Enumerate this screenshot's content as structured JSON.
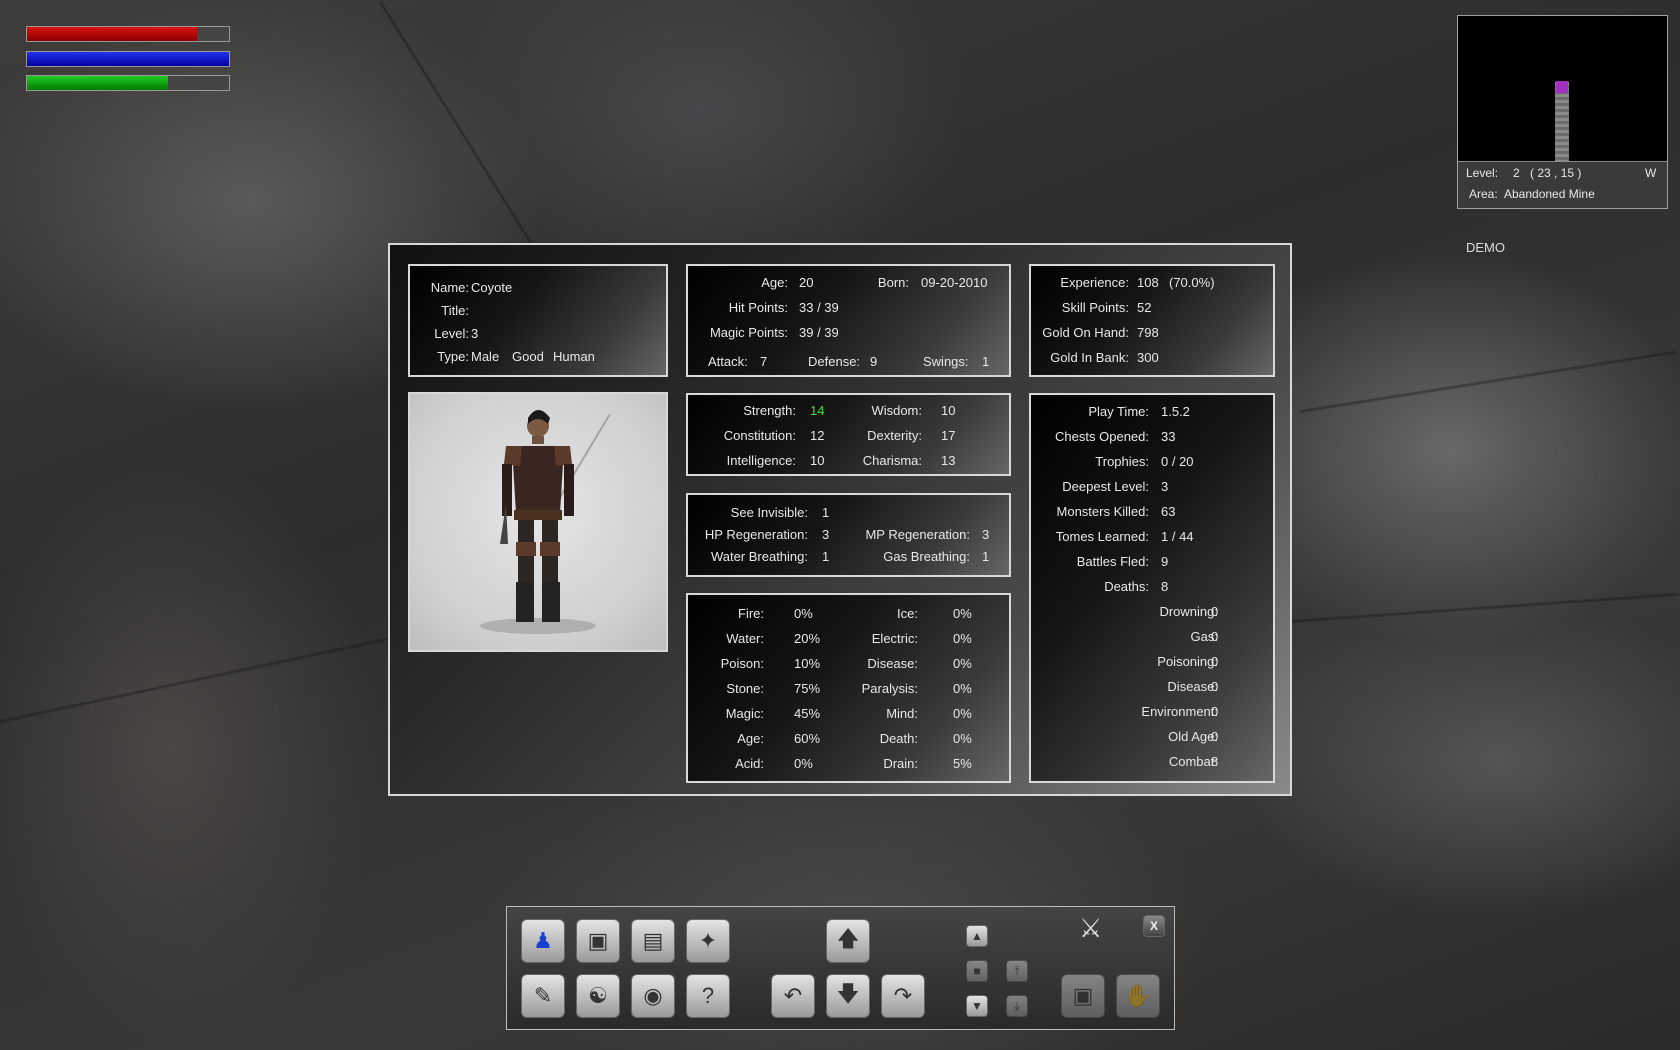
{
  "status_bars": {
    "health": 0.84,
    "mana": 1.0,
    "stamina": 0.7
  },
  "minimap": {
    "level_label": "Level:",
    "level_value": "2",
    "coords": "( 23 , 15 )",
    "facing": "W",
    "area_label": "Area:",
    "area_value": "Abandoned Mine"
  },
  "demo_label": "DEMO",
  "identity": {
    "name_label": "Name:",
    "name": "Coyote",
    "title_label": "Title:",
    "title": "",
    "level_label": "Level:",
    "level": "3",
    "type_label": "Type:",
    "gender": "Male",
    "alignment": "Good",
    "race": "Human"
  },
  "vitals": {
    "age_label": "Age:",
    "age": "20",
    "born_label": "Born:",
    "born": "09-20-2010",
    "hp_label": "Hit Points:",
    "hp": "33 / 39",
    "mp_label": "Magic Points:",
    "mp": "39 / 39",
    "attack_label": "Attack:",
    "attack": "7",
    "defense_label": "Defense:",
    "defense": "9",
    "swings_label": "Swings:",
    "swings": "1"
  },
  "progress": {
    "exp_label": "Experience:",
    "exp": "108",
    "exp_pct": "(70.0%)",
    "skill_label": "Skill Points:",
    "skill": "52",
    "gold_hand_label": "Gold On Hand:",
    "gold_hand": "798",
    "gold_bank_label": "Gold In Bank:",
    "gold_bank": "300"
  },
  "attributes": {
    "str_label": "Strength:",
    "str": "14",
    "wis_label": "Wisdom:",
    "wis": "10",
    "con_label": "Constitution:",
    "con": "12",
    "dex_label": "Dexterity:",
    "dex": "17",
    "int_label": "Intelligence:",
    "int": "10",
    "cha_label": "Charisma:",
    "cha": "13"
  },
  "abilities": {
    "see_inv_label": "See Invisible:",
    "see_inv": "1",
    "hp_regen_label": "HP Regeneration:",
    "hp_regen": "3",
    "mp_regen_label": "MP Regeneration:",
    "mp_regen": "3",
    "water_label": "Water Breathing:",
    "water": "1",
    "gas_label": "Gas Breathing:",
    "gas": "1"
  },
  "resistances": [
    {
      "l1": "Fire:",
      "v1": "0%",
      "l2": "Ice:",
      "v2": "0%"
    },
    {
      "l1": "Water:",
      "v1": "20%",
      "l2": "Electric:",
      "v2": "0%"
    },
    {
      "l1": "Poison:",
      "v1": "10%",
      "l2": "Disease:",
      "v2": "0%"
    },
    {
      "l1": "Stone:",
      "v1": "75%",
      "l2": "Paralysis:",
      "v2": "0%"
    },
    {
      "l1": "Magic:",
      "v1": "45%",
      "l2": "Mind:",
      "v2": "0%"
    },
    {
      "l1": "Age:",
      "v1": "60%",
      "l2": "Death:",
      "v2": "0%"
    },
    {
      "l1": "Acid:",
      "v1": "0%",
      "l2": "Drain:",
      "v2": "5%"
    }
  ],
  "records": [
    {
      "label": "Play Time:",
      "value": "1.5.2"
    },
    {
      "label": "Chests Opened:",
      "value": "33"
    },
    {
      "label": "Trophies:",
      "value": "0 / 20"
    },
    {
      "label": "Deepest Level:",
      "value": "3"
    },
    {
      "label": "Monsters Killed:",
      "value": "63"
    },
    {
      "label": "Tomes Learned:",
      "value": "1 / 44"
    },
    {
      "label": "Battles Fled:",
      "value": "9"
    },
    {
      "label": "Deaths:",
      "value": "8"
    }
  ],
  "death_causes": [
    {
      "label": "Drowning:",
      "value": "0"
    },
    {
      "label": "Gas:",
      "value": "0"
    },
    {
      "label": "Poisoning:",
      "value": "0"
    },
    {
      "label": "Disease:",
      "value": "0"
    },
    {
      "label": "Environment:",
      "value": "0"
    },
    {
      "label": "Old Age:",
      "value": "0"
    },
    {
      "label": "Combat:",
      "value": "8"
    }
  ],
  "toolbar": {
    "close_label": "X",
    "help_label": "?"
  }
}
